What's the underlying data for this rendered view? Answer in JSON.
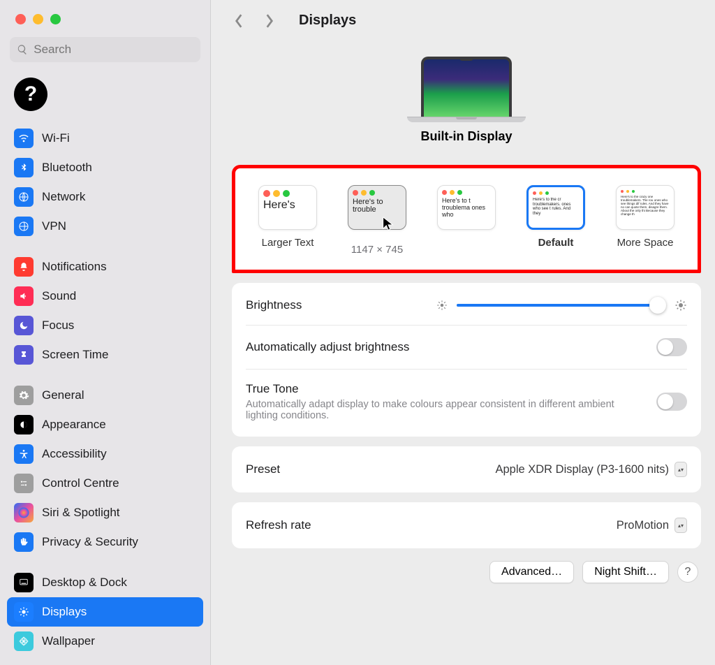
{
  "window": {
    "title": "Displays"
  },
  "search": {
    "placeholder": "Search"
  },
  "sidebar": {
    "groups": [
      [
        {
          "label": "Wi-Fi",
          "icon": "wifi",
          "bg": "#1a78f4"
        },
        {
          "label": "Bluetooth",
          "icon": "bluetooth",
          "bg": "#1a78f4"
        },
        {
          "label": "Network",
          "icon": "network",
          "bg": "#1a78f4"
        },
        {
          "label": "VPN",
          "icon": "vpn",
          "bg": "#1a78f4"
        }
      ],
      [
        {
          "label": "Notifications",
          "icon": "bell",
          "bg": "#ff3b30"
        },
        {
          "label": "Sound",
          "icon": "sound",
          "bg": "#ff2d55"
        },
        {
          "label": "Focus",
          "icon": "moon",
          "bg": "#5856d6"
        },
        {
          "label": "Screen Time",
          "icon": "hourglass",
          "bg": "#5856d6"
        }
      ],
      [
        {
          "label": "General",
          "icon": "gear",
          "bg": "#9e9e9e"
        },
        {
          "label": "Appearance",
          "icon": "appearance",
          "bg": "#000000"
        },
        {
          "label": "Accessibility",
          "icon": "accessibility",
          "bg": "#1a78f4"
        },
        {
          "label": "Control Centre",
          "icon": "control",
          "bg": "#9e9e9e"
        },
        {
          "label": "Siri & Spotlight",
          "icon": "siri",
          "bg": "linear-gradient(135deg,#2b6cf6,#e94fa1,#f7a83b)"
        },
        {
          "label": "Privacy & Security",
          "icon": "hand",
          "bg": "#1a78f4"
        }
      ],
      [
        {
          "label": "Desktop & Dock",
          "icon": "dock",
          "bg": "#000000"
        },
        {
          "label": "Displays",
          "icon": "display",
          "bg": "#1a78f4",
          "selected": true
        },
        {
          "label": "Wallpaper",
          "icon": "wallpaper",
          "bg": "#3ccadd"
        }
      ]
    ]
  },
  "main": {
    "display_name": "Built-in Display",
    "resolutions": {
      "items": [
        {
          "label": "Larger Text",
          "sample": "Here's",
          "size": "lg"
        },
        {
          "label": "",
          "sample": "Here's to trouble",
          "size": "med",
          "hovered": true,
          "sub": "1147 × 745"
        },
        {
          "label": "",
          "sample": "Here's to t troublema ones who",
          "size": "sm"
        },
        {
          "label": "Default",
          "sample": "Here's to the cr troublemakers. ones who see t rules. And they",
          "size": "xs",
          "selected": true
        },
        {
          "label": "More Space",
          "sample": "Here's to the crazy one troublemakers. The rou ones who see things dif rules. And they have no can quote them, disagre them. About the only thi Because they change th",
          "size": "xxs"
        }
      ]
    },
    "brightness": {
      "label": "Brightness"
    },
    "auto_brightness": {
      "label": "Automatically adjust brightness"
    },
    "true_tone": {
      "label": "True Tone",
      "desc": "Automatically adapt display to make colours appear consistent in different ambient lighting conditions."
    },
    "preset": {
      "label": "Preset",
      "value": "Apple XDR Display (P3-1600 nits)"
    },
    "refresh": {
      "label": "Refresh rate",
      "value": "ProMotion"
    },
    "buttons": {
      "advanced": "Advanced…",
      "night_shift": "Night Shift…"
    }
  }
}
